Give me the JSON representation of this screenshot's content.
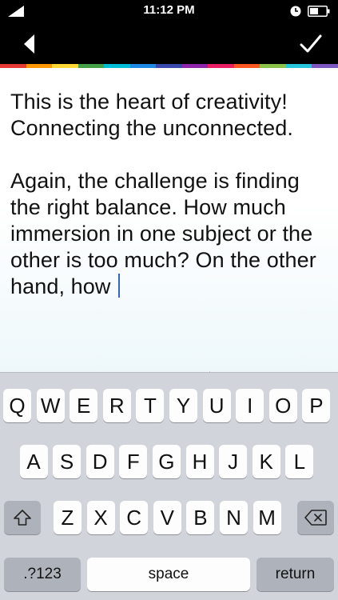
{
  "status_bar": {
    "time": "11:12 PM",
    "icons": [
      "signal-icon",
      "clock-icon",
      "battery-icon"
    ]
  },
  "nav": {
    "back_icon": "chevron-left-icon",
    "done_icon": "checkmark-icon"
  },
  "stripe_colors": [
    "#e53935",
    "#ff9800",
    "#fdd835",
    "#43a047",
    "#00bcd4",
    "#1e88e5",
    "#3949ab",
    "#8e24aa",
    "#e91e63",
    "#ff5722",
    "#8bc34a",
    "#26c6da",
    "#7e57c2"
  ],
  "editor": {
    "paragraph_1": "This is the heart of creativity! Connecting the unconnected.",
    "paragraph_2": "Again, the challenge is finding the right balance. How much immersion in one subject or the other is too much? On the other hand, how ",
    "caret_color": "#3a63c9"
  },
  "keyboard": {
    "row1": [
      "Q",
      "W",
      "E",
      "R",
      "T",
      "Y",
      "U",
      "I",
      "O",
      "P"
    ],
    "row2": [
      "A",
      "S",
      "D",
      "F",
      "G",
      "H",
      "J",
      "K",
      "L"
    ],
    "row3": [
      "Z",
      "X",
      "C",
      "V",
      "B",
      "N",
      "M"
    ],
    "shift_icon": "shift-icon",
    "delete_icon": "delete-icon",
    "numbers_label": ".?123",
    "space_label": "space",
    "return_label": "return"
  }
}
